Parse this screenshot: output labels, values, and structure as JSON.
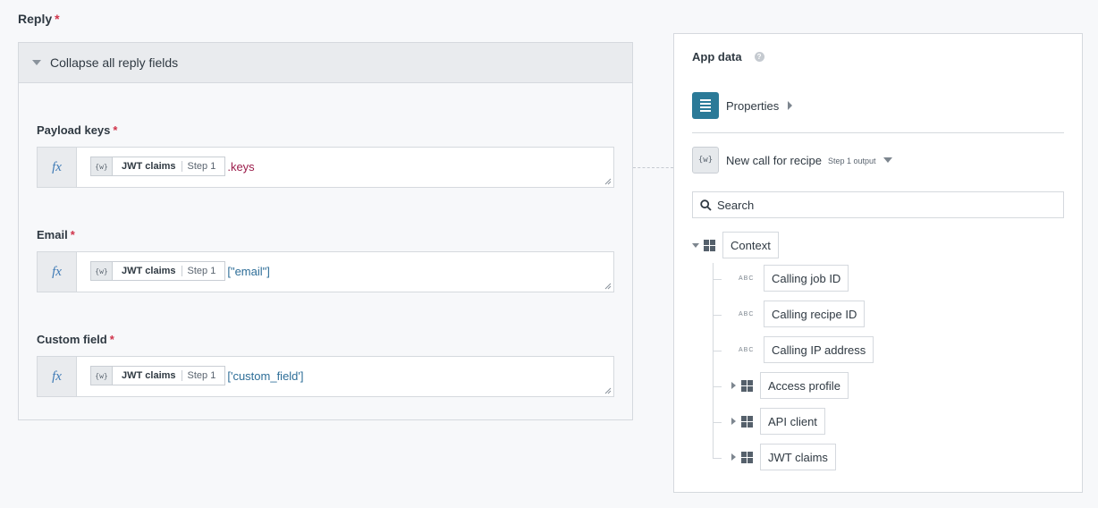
{
  "reply": {
    "label": "Reply",
    "required_mark": "*",
    "collapse_label": "Collapse all reply fields",
    "fields": [
      {
        "label": "Payload keys",
        "required_mark": "*",
        "fx": "fx",
        "pill_icon": "{w}",
        "pill_name": "JWT claims",
        "pill_step": "Step 1",
        "suffix": ".keys"
      },
      {
        "label": "Email",
        "required_mark": "*",
        "fx": "fx",
        "pill_icon": "{w}",
        "pill_name": "JWT claims",
        "pill_step": "Step 1",
        "suffix": "[\"email\"]"
      },
      {
        "label": "Custom field",
        "required_mark": "*",
        "fx": "fx",
        "pill_icon": "{w}",
        "pill_name": "JWT claims",
        "pill_step": "Step 1",
        "suffix": "['custom_field']"
      }
    ]
  },
  "app_data": {
    "title": "App data",
    "help_icon": "?",
    "properties_label": "Properties",
    "call_icon": "{w}",
    "call_label": "New call for recipe",
    "call_step": "Step 1 output",
    "search_placeholder": "Search",
    "tree": {
      "root": "Context",
      "abc_label": "ABC",
      "children": [
        {
          "label": "Calling job ID",
          "type": "text"
        },
        {
          "label": "Calling recipe ID",
          "type": "text"
        },
        {
          "label": "Calling IP address",
          "type": "text"
        },
        {
          "label": "Access profile",
          "type": "object"
        },
        {
          "label": "API client",
          "type": "object"
        },
        {
          "label": "JWT claims",
          "type": "object"
        }
      ]
    }
  },
  "colors": {
    "accent": "#2b7a98",
    "required": "#d0334a",
    "keys_suffix": "#9b1c4a",
    "string_suffix": "#2e6e98"
  }
}
